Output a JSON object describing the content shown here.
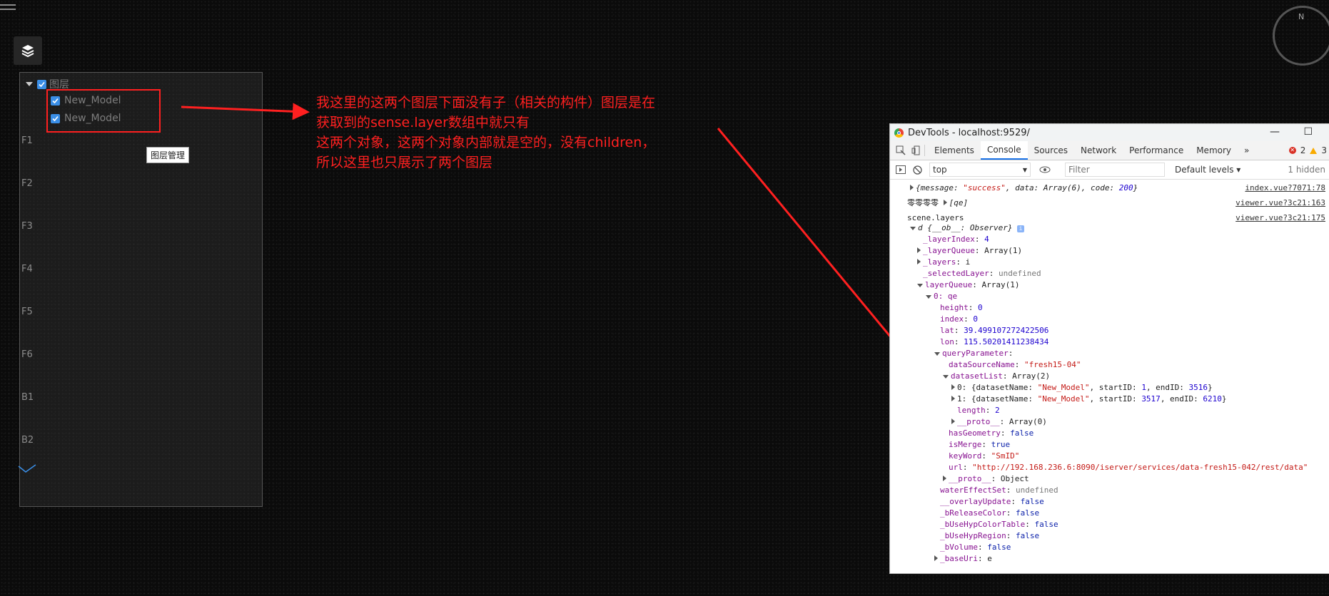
{
  "app": {
    "menu_icon": "hamburger-icon",
    "layer_button_icon": "layers-icon"
  },
  "layer_tree": {
    "root_label": "图层",
    "items": [
      "New_Model",
      "New_Model"
    ],
    "floors": [
      "F1",
      "F2",
      "F3",
      "F4",
      "F5",
      "F6",
      "B1",
      "B2"
    ]
  },
  "tooltip": "图层管理",
  "annotation": {
    "lines": [
      "我这里的这两个图层下面没有子（相关的构件）图层是在",
      "获取到的sense.layer数组中就只有",
      "这两个对象，这两个对象内部就是空的，没有children，",
      "所以这里也只展示了两个图层"
    ]
  },
  "compass": {
    "letter": "N"
  },
  "colors": {
    "annotation": "#ff2020",
    "checkbox": "#3a8ee6",
    "devtools_tab_active": "#1a73e8"
  },
  "devtools": {
    "title": "DevTools - localhost:9529/",
    "tabs": [
      "Elements",
      "Console",
      "Sources",
      "Network",
      "Performance",
      "Memory"
    ],
    "active_tab": "Console",
    "more": "»",
    "errors": "2",
    "warnings": "3",
    "context": "top",
    "filter_placeholder": "Filter",
    "levels": "Default levels ▾",
    "hidden": "1 hidden",
    "sources": {
      "s1": "index.vue?7071:78",
      "s2": "viewer.vue?3c21:163",
      "s3": "viewer.vue?3c21:175"
    },
    "lines": {
      "msg_prefix": "{message: ",
      "msg_success": "\"success\"",
      "msg_mid": ", data: Array(6), code: ",
      "msg_code": "200",
      "msg_end": "}",
      "zero_label": "零零零零",
      "zero_value": "[qe]",
      "scene_layers": "scene.layers",
      "obj_d": "d {__ob__: Observer}",
      "layerIndex_k": "_layerIndex",
      "layerIndex_v": "4",
      "layerQueue_k": "_layerQueue",
      "layerQueue_v": "Array(1)",
      "layers_k": "_layers",
      "layers_v": "i",
      "selectedLayer_k": "_selectedLayer",
      "selectedLayer_v": "undefined",
      "layerQueue2_k": "layerQueue",
      "layerQueue2_v": "Array(1)",
      "item0": "0: qe",
      "height_k": "height",
      "height_v": "0",
      "index_k": "index",
      "index_v": "0",
      "lat_k": "lat",
      "lat_v": "39.499107272422506",
      "lon_k": "lon",
      "lon_v": "115.50201411238434",
      "query_k": "queryParameter",
      "dsName_k": "dataSourceName",
      "dsName_v": "\"fresh15-04\"",
      "dsList_k": "datasetList",
      "dsList_v": "Array(2)",
      "ds0_pre": "0: {datasetName: ",
      "ds_name": "\"New_Model\"",
      "ds0_a": ", startID: ",
      "ds0_start": "1",
      "ds0_b": ", endID: ",
      "ds0_end": "3516",
      "ds1_pre": "1: {datasetName: ",
      "ds1_start": "3517",
      "ds1_end": "6210",
      "close_brace": "}",
      "length_k": "length",
      "length_v": "2",
      "proto_k": "__proto__",
      "proto_arr": "Array(0)",
      "hasGeo_k": "hasGeometry",
      "hasGeo_v": "false",
      "isMerge_k": "isMerge",
      "isMerge_v": "true",
      "keyWord_k": "keyWord",
      "keyWord_v": "\"SmID\"",
      "url_k": "url",
      "url_v": "\"http://192.168.236.6:8090/iserver/services/data-fresh15-042/rest/data\"",
      "proto_obj": "Object",
      "water_k": "waterEffectSet",
      "water_v": "undefined",
      "overlay_k": "__overlayUpdate",
      "overlay_v": "false",
      "brelease_k": "_bReleaseColor",
      "brelease_v": "false",
      "bhyp_k": "_bUseHypColorTable",
      "bhyp_v": "false",
      "bhypreg_k": "_bUseHypRegion",
      "bhypreg_v": "false",
      "bvolume_k": "_bVolume",
      "bvolume_v": "false",
      "baseUri_k": "_baseUri",
      "baseUri_v": "e"
    }
  }
}
